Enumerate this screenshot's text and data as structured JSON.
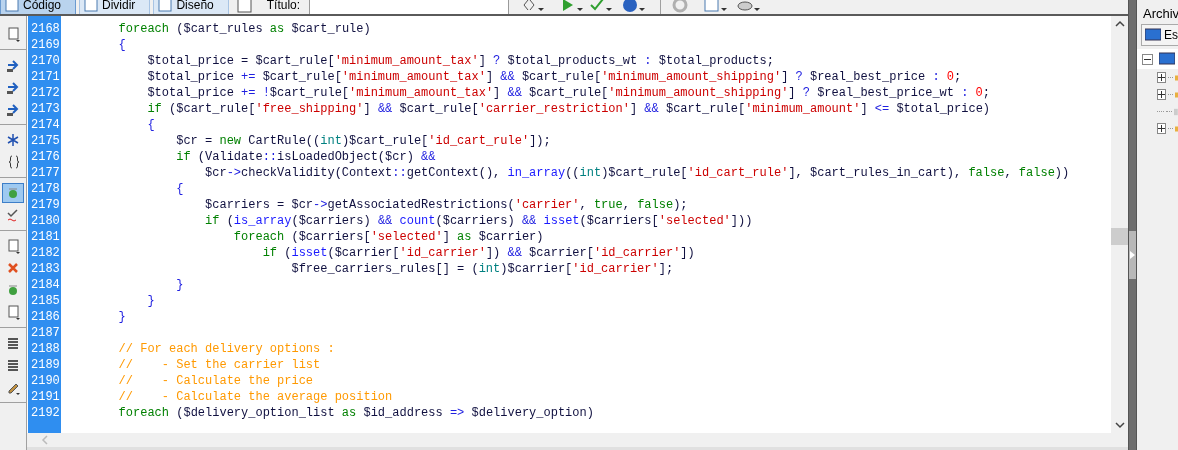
{
  "toolbar": {
    "view_buttons": [
      {
        "label": "Código",
        "selected": true
      },
      {
        "label": "Dividir",
        "selected": false
      },
      {
        "label": "Diseño",
        "selected": false
      }
    ],
    "title_label": "Título:"
  },
  "left_toolbar": [
    {
      "buttons": [
        {
          "kind": "page",
          "selected": false
        }
      ]
    },
    {
      "buttons": [
        {
          "kind": "arrow",
          "selected": false
        },
        {
          "kind": "arrow",
          "selected": false
        },
        {
          "kind": "arrow",
          "selected": false
        }
      ]
    },
    {
      "buttons": [
        {
          "kind": "star",
          "selected": false
        },
        {
          "kind": "brace",
          "selected": false
        }
      ]
    },
    {
      "buttons": [
        {
          "kind": "gem",
          "selected": true
        },
        {
          "kind": "check",
          "selected": false
        }
      ]
    },
    {
      "buttons": [
        {
          "kind": "page",
          "selected": false
        },
        {
          "kind": "cross",
          "selected": false
        },
        {
          "kind": "gem",
          "selected": false
        },
        {
          "kind": "page",
          "selected": false
        }
      ]
    },
    {
      "buttons": [
        {
          "kind": "list",
          "selected": false
        },
        {
          "kind": "list",
          "selected": false
        },
        {
          "kind": "pen",
          "selected": false
        }
      ]
    }
  ],
  "editor": {
    "lines": [
      {
        "number": "2168",
        "tokens": [
          {
            "kind": "kw",
            "text": "        foreach"
          },
          {
            "kind": "plain",
            "text": " ($cart_rules "
          },
          {
            "kind": "kw",
            "text": "as"
          },
          {
            "kind": "plain",
            "text": " $cart_rule)"
          }
        ]
      },
      {
        "number": "2169",
        "tokens": [
          {
            "kind": "op",
            "text": "        {"
          }
        ]
      },
      {
        "number": "2170",
        "tokens": [
          {
            "kind": "plain",
            "text": "            $total_price = $cart_rule["
          },
          {
            "kind": "str",
            "text": "'minimum_amount_tax'"
          },
          {
            "kind": "plain",
            "text": "] "
          },
          {
            "kind": "op",
            "text": "?"
          },
          {
            "kind": "plain",
            "text": " $total_products_wt "
          },
          {
            "kind": "op",
            "text": ":"
          },
          {
            "kind": "plain",
            "text": " $total_products;"
          }
        ]
      },
      {
        "number": "2171",
        "tokens": [
          {
            "kind": "plain",
            "text": "            $total_price "
          },
          {
            "kind": "op",
            "text": "+="
          },
          {
            "kind": "plain",
            "text": " $cart_rule["
          },
          {
            "kind": "str",
            "text": "'minimum_amount_tax'"
          },
          {
            "kind": "plain",
            "text": "] "
          },
          {
            "kind": "op",
            "text": "&&"
          },
          {
            "kind": "plain",
            "text": " $cart_rule["
          },
          {
            "kind": "str",
            "text": "'minimum_amount_shipping'"
          },
          {
            "kind": "plain",
            "text": "] "
          },
          {
            "kind": "op",
            "text": "?"
          },
          {
            "kind": "plain",
            "text": " $real_best_price "
          },
          {
            "kind": "op",
            "text": ":"
          },
          {
            "kind": "num",
            "text": " 0"
          },
          {
            "kind": "plain",
            "text": ";"
          }
        ]
      },
      {
        "number": "2172",
        "tokens": [
          {
            "kind": "plain",
            "text": "            $total_price "
          },
          {
            "kind": "op",
            "text": "+= !"
          },
          {
            "kind": "plain",
            "text": "$cart_rule["
          },
          {
            "kind": "str",
            "text": "'minimum_amount_tax'"
          },
          {
            "kind": "plain",
            "text": "] "
          },
          {
            "kind": "op",
            "text": "&&"
          },
          {
            "kind": "plain",
            "text": " $cart_rule["
          },
          {
            "kind": "str",
            "text": "'minimum_amount_shipping'"
          },
          {
            "kind": "plain",
            "text": "] "
          },
          {
            "kind": "op",
            "text": "?"
          },
          {
            "kind": "plain",
            "text": " $real_best_price_wt "
          },
          {
            "kind": "op",
            "text": ":"
          },
          {
            "kind": "num",
            "text": " 0"
          },
          {
            "kind": "plain",
            "text": ";"
          }
        ]
      },
      {
        "number": "2173",
        "tokens": [
          {
            "kind": "kw",
            "text": "            if"
          },
          {
            "kind": "plain",
            "text": " ($cart_rule["
          },
          {
            "kind": "str",
            "text": "'free_shipping'"
          },
          {
            "kind": "plain",
            "text": "] "
          },
          {
            "kind": "op",
            "text": "&&"
          },
          {
            "kind": "plain",
            "text": " $cart_rule["
          },
          {
            "kind": "str",
            "text": "'carrier_restriction'"
          },
          {
            "kind": "plain",
            "text": "] "
          },
          {
            "kind": "op",
            "text": "&&"
          },
          {
            "kind": "plain",
            "text": " $cart_rule["
          },
          {
            "kind": "str",
            "text": "'minimum_amount'"
          },
          {
            "kind": "plain",
            "text": "] "
          },
          {
            "kind": "op",
            "text": "<="
          },
          {
            "kind": "plain",
            "text": " $total_price)"
          }
        ]
      },
      {
        "number": "2174",
        "tokens": [
          {
            "kind": "op",
            "text": "            {"
          }
        ]
      },
      {
        "number": "2175",
        "tokens": [
          {
            "kind": "plain",
            "text": "                $cr = "
          },
          {
            "kind": "kw",
            "text": "new"
          },
          {
            "kind": "plain",
            "text": " CartRule(("
          },
          {
            "kind": "cast",
            "text": "int"
          },
          {
            "kind": "plain",
            "text": ")$cart_rule["
          },
          {
            "kind": "str",
            "text": "'id_cart_rule'"
          },
          {
            "kind": "plain",
            "text": "]);"
          }
        ]
      },
      {
        "number": "2176",
        "tokens": [
          {
            "kind": "kw",
            "text": "                if"
          },
          {
            "kind": "plain",
            "text": " (Validate"
          },
          {
            "kind": "op",
            "text": "::"
          },
          {
            "kind": "plain",
            "text": "isLoadedObject($cr) "
          },
          {
            "kind": "op",
            "text": "&&"
          }
        ]
      },
      {
        "number": "2177",
        "tokens": [
          {
            "kind": "plain",
            "text": "                    $cr"
          },
          {
            "kind": "op",
            "text": "->"
          },
          {
            "kind": "plain",
            "text": "checkValidity(Context"
          },
          {
            "kind": "op",
            "text": "::"
          },
          {
            "kind": "plain",
            "text": "getContext(), "
          },
          {
            "kind": "fn",
            "text": "in_array"
          },
          {
            "kind": "plain",
            "text": "(("
          },
          {
            "kind": "cast",
            "text": "int"
          },
          {
            "kind": "plain",
            "text": ")$cart_rule["
          },
          {
            "kind": "str",
            "text": "'id_cart_rule'"
          },
          {
            "kind": "plain",
            "text": "], $cart_rules_in_cart), "
          },
          {
            "kind": "kw",
            "text": "false"
          },
          {
            "kind": "plain",
            "text": ", "
          },
          {
            "kind": "kw",
            "text": "false"
          },
          {
            "kind": "plain",
            "text": "))"
          }
        ]
      },
      {
        "number": "2178",
        "tokens": [
          {
            "kind": "op",
            "text": "                {"
          }
        ]
      },
      {
        "number": "2179",
        "tokens": [
          {
            "kind": "plain",
            "text": "                    $carriers = $cr"
          },
          {
            "kind": "op",
            "text": "->"
          },
          {
            "kind": "plain",
            "text": "getAssociatedRestrictions("
          },
          {
            "kind": "str",
            "text": "'carrier'"
          },
          {
            "kind": "plain",
            "text": ", "
          },
          {
            "kind": "kw",
            "text": "true"
          },
          {
            "kind": "plain",
            "text": ", "
          },
          {
            "kind": "kw",
            "text": "false"
          },
          {
            "kind": "plain",
            "text": ");"
          }
        ]
      },
      {
        "number": "2180",
        "tokens": [
          {
            "kind": "kw",
            "text": "                    if"
          },
          {
            "kind": "plain",
            "text": " ("
          },
          {
            "kind": "fn",
            "text": "is_array"
          },
          {
            "kind": "plain",
            "text": "($carriers) "
          },
          {
            "kind": "op",
            "text": "&&"
          },
          {
            "kind": "fn",
            "text": " count"
          },
          {
            "kind": "plain",
            "text": "($carriers) "
          },
          {
            "kind": "op",
            "text": "&&"
          },
          {
            "kind": "fn",
            "text": " isset"
          },
          {
            "kind": "plain",
            "text": "($carriers["
          },
          {
            "kind": "str",
            "text": "'selected'"
          },
          {
            "kind": "plain",
            "text": "]))"
          }
        ]
      },
      {
        "number": "2181",
        "tokens": [
          {
            "kind": "kw",
            "text": "                        foreach"
          },
          {
            "kind": "plain",
            "text": " ($carriers["
          },
          {
            "kind": "str",
            "text": "'selected'"
          },
          {
            "kind": "plain",
            "text": "] "
          },
          {
            "kind": "kw",
            "text": "as"
          },
          {
            "kind": "plain",
            "text": " $carrier)"
          }
        ]
      },
      {
        "number": "2182",
        "tokens": [
          {
            "kind": "kw",
            "text": "                            if"
          },
          {
            "kind": "plain",
            "text": " ("
          },
          {
            "kind": "fn",
            "text": "isset"
          },
          {
            "kind": "plain",
            "text": "($carrier["
          },
          {
            "kind": "str",
            "text": "'id_carrier'"
          },
          {
            "kind": "plain",
            "text": "]) "
          },
          {
            "kind": "op",
            "text": "&&"
          },
          {
            "kind": "plain",
            "text": " $carrier["
          },
          {
            "kind": "str",
            "text": "'id_carrier'"
          },
          {
            "kind": "plain",
            "text": "])"
          }
        ]
      },
      {
        "number": "2183",
        "tokens": [
          {
            "kind": "plain",
            "text": "                                $free_carriers_rules[] = ("
          },
          {
            "kind": "cast",
            "text": "int"
          },
          {
            "kind": "plain",
            "text": ")$carrier["
          },
          {
            "kind": "str",
            "text": "'id_carrier'"
          },
          {
            "kind": "plain",
            "text": "];"
          }
        ]
      },
      {
        "number": "2184",
        "tokens": [
          {
            "kind": "op",
            "text": "                }"
          }
        ]
      },
      {
        "number": "2185",
        "tokens": [
          {
            "kind": "op",
            "text": "            }"
          }
        ]
      },
      {
        "number": "2186",
        "tokens": [
          {
            "kind": "op",
            "text": "        }"
          }
        ]
      },
      {
        "number": "2187"
      },
      {
        "number": "2188",
        "tokens": [
          {
            "kind": "cmt",
            "text": "        // For each delivery options :"
          }
        ]
      },
      {
        "number": "2189",
        "tokens": [
          {
            "kind": "cmt",
            "text": "        //    - Set the carrier list"
          }
        ]
      },
      {
        "number": "2190",
        "tokens": [
          {
            "kind": "cmt",
            "text": "        //    - Calculate the price"
          }
        ]
      },
      {
        "number": "2191",
        "tokens": [
          {
            "kind": "cmt",
            "text": "        //    - Calculate the average position"
          }
        ]
      },
      {
        "number": "2192",
        "tokens": [
          {
            "kind": "kw",
            "text": "        foreach"
          },
          {
            "kind": "plain",
            "text": " ($delivery_option_list "
          },
          {
            "kind": "kw",
            "text": "as"
          },
          {
            "kind": "plain",
            "text": " $id_address "
          },
          {
            "kind": "op",
            "text": "=>"
          },
          {
            "kind": "plain",
            "text": " $delivery_option)"
          }
        ]
      }
    ]
  },
  "files_panel": {
    "title": "Archiv",
    "site_select": "Es",
    "tree": {
      "expanded": true,
      "children": [
        {
          "kind": "folder",
          "expanded": false
        },
        {
          "kind": "folder",
          "expanded": false
        },
        {
          "kind": "leaf",
          "expanded": false
        },
        {
          "kind": "folder",
          "expanded": false
        }
      ]
    }
  }
}
